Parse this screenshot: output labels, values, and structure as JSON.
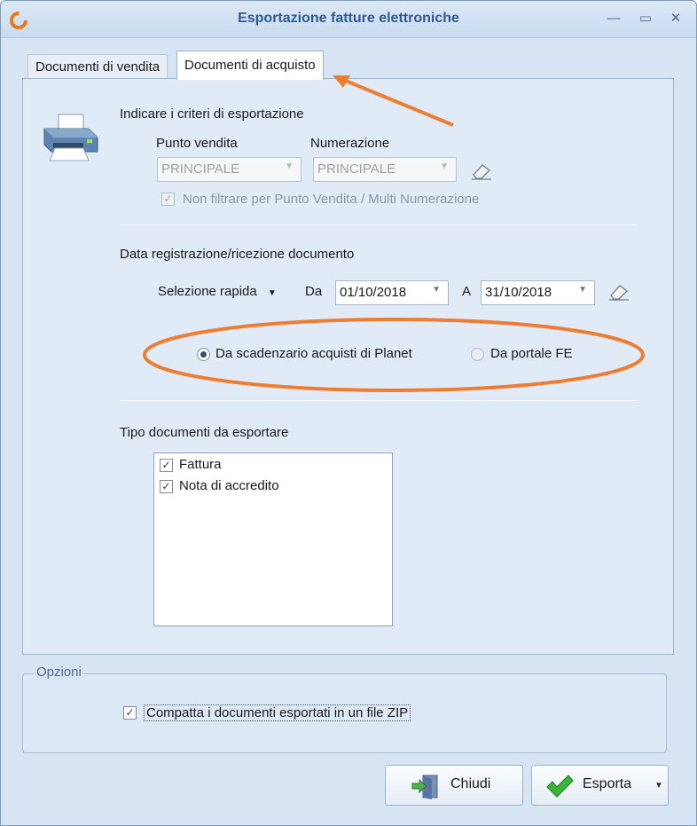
{
  "window": {
    "title": "Esportazione fatture elettroniche",
    "minimize": "—",
    "maximize": "▭",
    "close": "✕"
  },
  "tabs": [
    {
      "label": "Documenti di vendita",
      "active": false
    },
    {
      "label": "Documenti di acquisto",
      "active": true
    }
  ],
  "criteria": {
    "heading": "Indicare i criteri di esportazione",
    "punto_vendita": {
      "label": "Punto vendita",
      "value": "PRINCIPALE"
    },
    "numerazione": {
      "label": "Numerazione",
      "value": "PRINCIPALE"
    },
    "no_filter": {
      "label": "Non filtrare per Punto Vendita / Multi Numerazione",
      "checked": true
    }
  },
  "date_section": {
    "heading": "Data registrazione/ricezione documento",
    "quick_select": "Selezione rapida",
    "from_label": "Da",
    "from_value": "01/10/2018",
    "to_label": "A",
    "to_value": "31/10/2018",
    "source_options": [
      {
        "label": "Da scadenzario acquisti di Planet",
        "selected": true
      },
      {
        "label": "Da portale FE",
        "selected": false
      }
    ]
  },
  "doc_types": {
    "heading": "Tipo documenti da esportare",
    "items": [
      {
        "label": "Fattura",
        "checked": true
      },
      {
        "label": "Nota di accredito",
        "checked": true
      }
    ]
  },
  "options": {
    "title": "Opzioni",
    "zip": {
      "label": "Compatta i documenti esportati in un file ZIP",
      "checked": true
    }
  },
  "buttons": {
    "close": "Chiudi",
    "export": "Esporta"
  },
  "colors": {
    "annotation": "#ed7d31",
    "title": "#2d5b8a"
  }
}
